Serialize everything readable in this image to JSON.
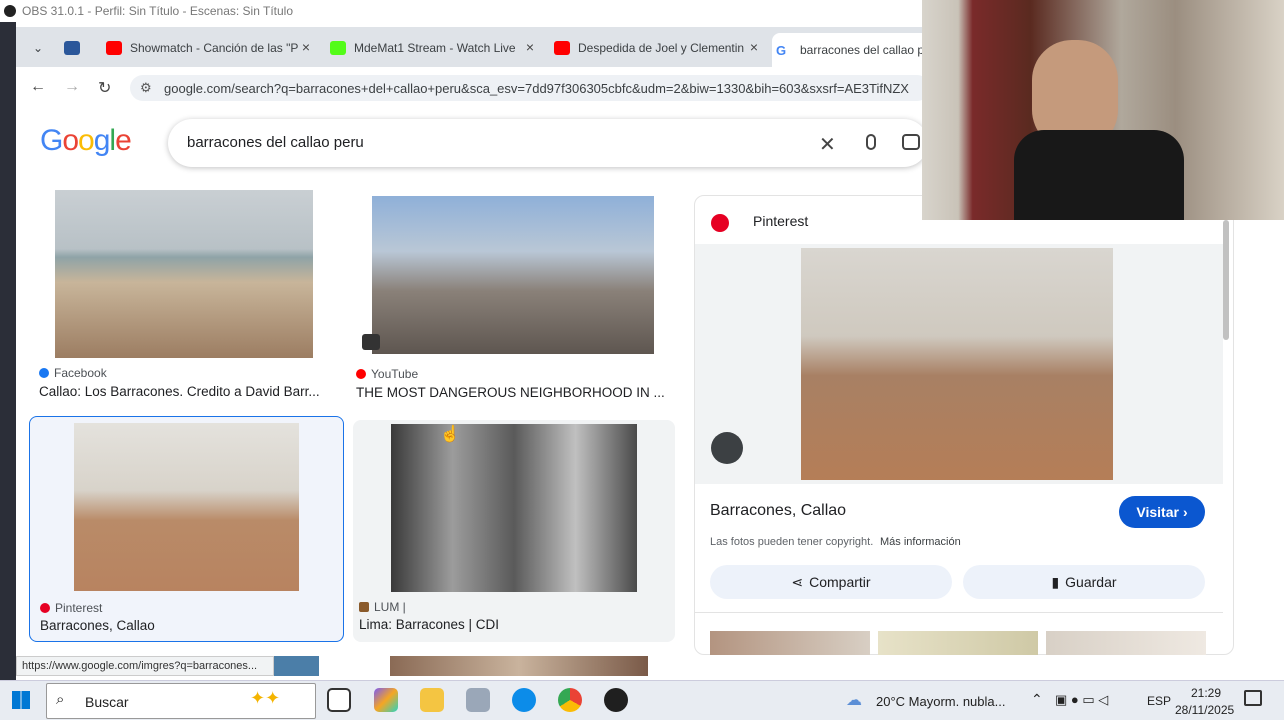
{
  "obs": {
    "title": "OBS 31.0.1 - Perfil: Sin Título - Escenas: Sin Título"
  },
  "browser": {
    "tabs": [
      {
        "label": "Showmatch - Canción de las \"P",
        "icon": "youtube-icon",
        "color": "#ff0000"
      },
      {
        "label": "MdeMat1 Stream - Watch Live",
        "icon": "kick-icon",
        "color": "#53fc18"
      },
      {
        "label": "Despedida de Joel y Clementin",
        "icon": "youtube-icon",
        "color": "#ff0000"
      },
      {
        "label": "barracones del callao per",
        "icon": "google-icon",
        "color": "#4285f4"
      }
    ],
    "url": "google.com/search?q=barracones+del+callao+peru&sca_esv=7dd97f306305cbfc&udm=2&biw=1330&bih=603&sxsrf=AE3TifNZX"
  },
  "google": {
    "logo": "Google",
    "query": "barracones del callao peru"
  },
  "results": [
    {
      "source": "Facebook",
      "title": "Callao: Los Barracones. Credito a David Barr...",
      "source_color": "#1877f2"
    },
    {
      "source": "YouTube",
      "title": "THE MOST DANGEROUS NEIGHBORHOOD IN ...",
      "source_color": "#ff0000"
    },
    {
      "source": "Pinterest",
      "title": "Barracones, Callao",
      "source_color": "#e60023"
    },
    {
      "source": "LUM |",
      "title": "Lima: Barracones | CDI",
      "source_color": "#8a5a2b"
    }
  ],
  "panel": {
    "source": "Pinterest",
    "title": "Barracones, Callao",
    "visit": "Visitar",
    "copyright": "Las fotos pueden tener copyright.",
    "more_info": "Más información",
    "share": "Compartir",
    "save": "Guardar"
  },
  "status_url": "https://www.google.com/imgres?q=barracones...",
  "taskbar": {
    "search_placeholder": "Buscar",
    "weather": "20°C  Mayorm. nubla...",
    "lang": "ESP",
    "time": "21:29",
    "date": "28/11/2025"
  }
}
